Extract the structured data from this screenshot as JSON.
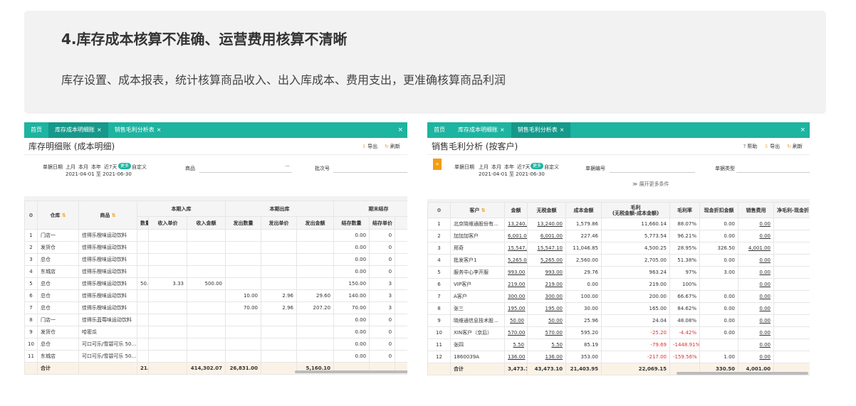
{
  "hero": {
    "title": "4.库存成本核算不准确、运营费用核算不清晰",
    "subtitle": "库存设置、成本报表，统计核算商品收入、出入库成本、费用支出，更准确核算商品利润"
  },
  "left_window": {
    "tabs": [
      {
        "label": "首页",
        "closable": false
      },
      {
        "label": "库存成本明细账",
        "closable": true,
        "active": true
      },
      {
        "label": "销售毛利分析表",
        "closable": true
      }
    ],
    "title": "库存明细账 (成本明细)",
    "actions": {
      "export": "导出",
      "refresh": "刷新"
    },
    "filters": {
      "date_label": "单据日期",
      "quick": [
        "上月",
        "本月",
        "本年",
        "近7天",
        "更多",
        "自定义"
      ],
      "date_range": "2021-04-01 至 2021-06-30",
      "product_label": "商品",
      "product_ellipsis": "···",
      "batch_label": "批次号"
    },
    "table": {
      "group_headers": {
        "in": "本期入库",
        "out": "本期出库",
        "end": "期末结存"
      },
      "headers": [
        "仓库",
        "商品",
        "数量",
        "收入单价",
        "收入金额",
        "发出数量",
        "发出单价",
        "发出金额",
        "结存数量",
        "结存单价"
      ],
      "rows": [
        [
          "1",
          "门店一",
          "佳得乐橙味运动饮料",
          "",
          "",
          "",
          "",
          "",
          "",
          "0.00",
          "0"
        ],
        [
          "2",
          "发货仓",
          "佳得乐橙味运动饮料",
          "",
          "",
          "",
          "",
          "",
          "",
          "0.00",
          "0"
        ],
        [
          "3",
          "总仓",
          "佳得乐橙味运动饮料",
          "",
          "",
          "",
          "",
          "",
          "",
          "0.00",
          "0"
        ],
        [
          "4",
          "东城店",
          "佳得乐橙味运动饮料",
          "",
          "",
          "",
          "",
          "",
          "",
          "0.00",
          "0"
        ],
        [
          "5",
          "总仓",
          "佳得乐橙味运动饮料",
          "50.00",
          "3.33",
          "500.00",
          "",
          "",
          "",
          "150.00",
          "3"
        ],
        [
          "6",
          "总仓",
          "佳得乐橙味运动饮料",
          "",
          "",
          "",
          "10.00",
          "2.96",
          "29.60",
          "140.00",
          "3"
        ],
        [
          "7",
          "总仓",
          "佳得乐橙味运动饮料",
          "",
          "",
          "",
          "70.00",
          "2.96",
          "207.20",
          "70.00",
          "3"
        ],
        [
          "8",
          "门店一",
          "佳得乐蓝莓味运动饮料",
          "",
          "",
          "",
          "",
          "",
          "",
          "0.00",
          "0"
        ],
        [
          "9",
          "发货仓",
          "哈密瓜",
          "",
          "",
          "",
          "",
          "",
          "",
          "0.00",
          "0"
        ],
        [
          "10",
          "总仓",
          "可口可乐/雪碧可乐 50...",
          "",
          "",
          "",
          "",
          "",
          "",
          "0.00",
          "0"
        ],
        [
          "11",
          "东城店",
          "可口可乐/雪碧可乐 50...",
          "",
          "",
          "",
          "",
          "",
          "",
          "0.00",
          "0"
        ]
      ],
      "total": [
        "合计",
        "",
        "21....",
        "",
        "414,302.07",
        "26,831.00",
        "",
        "5,160.10",
        "",
        ""
      ]
    }
  },
  "right_window": {
    "tabs": [
      {
        "label": "首页",
        "closable": false
      },
      {
        "label": "库存成本明细账",
        "closable": true
      },
      {
        "label": "销售毛利分析表",
        "closable": true,
        "active": true
      }
    ],
    "title": "销售毛利分析 (按客户)",
    "actions": {
      "help": "帮助",
      "export": "导出",
      "refresh": "刷新"
    },
    "filters": {
      "date_label": "单据日期",
      "quick": [
        "上月",
        "本月",
        "本年",
        "近7天",
        "更多",
        "自定义"
      ],
      "date_range": "2021-04-01 至 2021-06-30",
      "doc_no_label": "单据编号",
      "doc_type_label": "单据类型",
      "expand": "展开更多条件"
    },
    "table": {
      "headers": [
        "客户",
        "金额",
        "无税金额",
        "成本金额",
        "毛利\n(无税金额-成本金额)",
        "毛利率",
        "现金折扣金额",
        "销售费用",
        "净毛利-现金折"
      ],
      "rows": [
        [
          "1",
          "北京晓维通股份有...",
          "13,240.00",
          "13,240.00",
          "1,579.86",
          "11,660.14",
          "88.07%",
          "0.00",
          "0.00"
        ],
        [
          "2",
          "加加加客户",
          "6,001.00",
          "6,001.00",
          "227.46",
          "5,773.54",
          "96.21%",
          "0.00",
          "0.00"
        ],
        [
          "3",
          "邢奇",
          "15,547.10",
          "15,547.10",
          "11,046.85",
          "4,500.25",
          "28.95%",
          "326.50",
          "4,001.00"
        ],
        [
          "4",
          "批发客户1",
          "5,265.00",
          "5,265.00",
          "2,560.00",
          "2,705.00",
          "51.38%",
          "0.00",
          "0.00"
        ],
        [
          "5",
          "服务中心李开服",
          "993.00",
          "993.00",
          "29.76",
          "963.24",
          "97%",
          "3.00",
          "0.00"
        ],
        [
          "6",
          "VIP客户",
          "219.00",
          "219.00",
          "0.00",
          "219.00",
          "100%",
          "",
          "0.00"
        ],
        [
          "7",
          "A客户",
          "300.00",
          "300.00",
          "100.00",
          "200.00",
          "66.67%",
          "0.00",
          "0.00"
        ],
        [
          "8",
          "张三",
          "195.00",
          "195.00",
          "30.00",
          "165.00",
          "84.62%",
          "0.00",
          "0.00"
        ],
        [
          "9",
          "晓维通信息技术股...",
          "50.00",
          "50.00",
          "25.96",
          "24.04",
          "48.08%",
          "0.00",
          "0.00"
        ],
        [
          "10",
          "XIN客户（京后）",
          "570.00",
          "570.00",
          "595.20",
          "-25.20",
          "-4.42%",
          "0.00",
          "0.00"
        ],
        [
          "11",
          "张四",
          "5.50",
          "5.50",
          "85.19",
          "-79.69",
          "-1448.91%",
          "",
          "0.00"
        ],
        [
          "12",
          "1860039A",
          "136.00",
          "136.00",
          "353.00",
          "-217.00",
          "-159.56%",
          "1.00",
          "0.00"
        ]
      ],
      "total": [
        "合计",
        "3,473.10",
        "43,473.10",
        "21,403.95",
        "22,069.15",
        "",
        "330.50",
        "4,001.00"
      ]
    }
  }
}
